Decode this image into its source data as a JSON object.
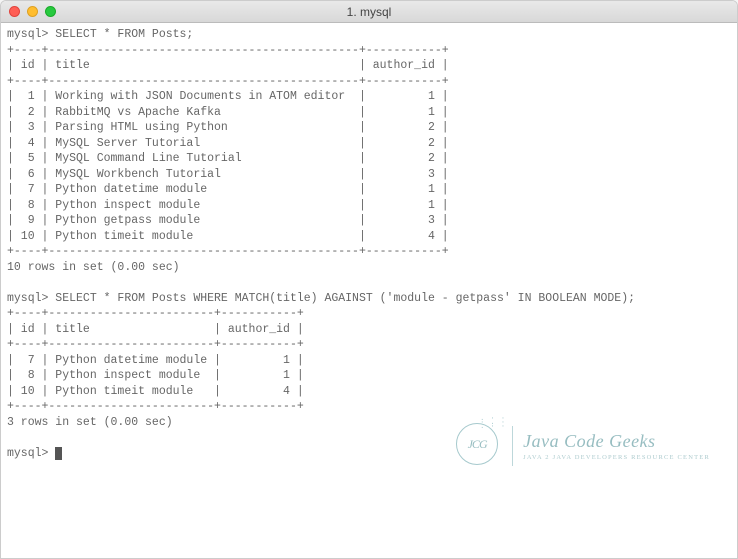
{
  "window": {
    "title": "1. mysql"
  },
  "prompt": "mysql>",
  "query1": {
    "sql": "SELECT * FROM Posts;",
    "columns": [
      "id",
      "title",
      "author_id"
    ],
    "rows": [
      {
        "id": "1",
        "title": "Working with JSON Documents in ATOM editor",
        "author_id": "1"
      },
      {
        "id": "2",
        "title": "RabbitMQ vs Apache Kafka",
        "author_id": "1"
      },
      {
        "id": "3",
        "title": "Parsing HTML using Python",
        "author_id": "2"
      },
      {
        "id": "4",
        "title": "MySQL Server Tutorial",
        "author_id": "2"
      },
      {
        "id": "5",
        "title": "MySQL Command Line Tutorial",
        "author_id": "2"
      },
      {
        "id": "6",
        "title": "MySQL Workbench Tutorial",
        "author_id": "3"
      },
      {
        "id": "7",
        "title": "Python datetime module",
        "author_id": "1"
      },
      {
        "id": "8",
        "title": "Python inspect module",
        "author_id": "1"
      },
      {
        "id": "9",
        "title": "Python getpass module",
        "author_id": "3"
      },
      {
        "id": "10",
        "title": "Python timeit module",
        "author_id": "4"
      }
    ],
    "status": "10 rows in set (0.00 sec)"
  },
  "query2": {
    "sql": "SELECT * FROM Posts WHERE MATCH(title) AGAINST ('module - getpass' IN BOOLEAN MODE);",
    "columns": [
      "id",
      "title",
      "author_id"
    ],
    "rows": [
      {
        "id": "7",
        "title": "Python datetime module",
        "author_id": "1"
      },
      {
        "id": "8",
        "title": "Python inspect module",
        "author_id": "1"
      },
      {
        "id": "10",
        "title": "Python timeit module",
        "author_id": "4"
      }
    ],
    "status": "3 rows in set (0.00 sec)"
  },
  "watermark": {
    "logo_text": "JCG",
    "main": "Java Code Geeks",
    "sub": "Java 2 Java Developers Resource Center"
  }
}
